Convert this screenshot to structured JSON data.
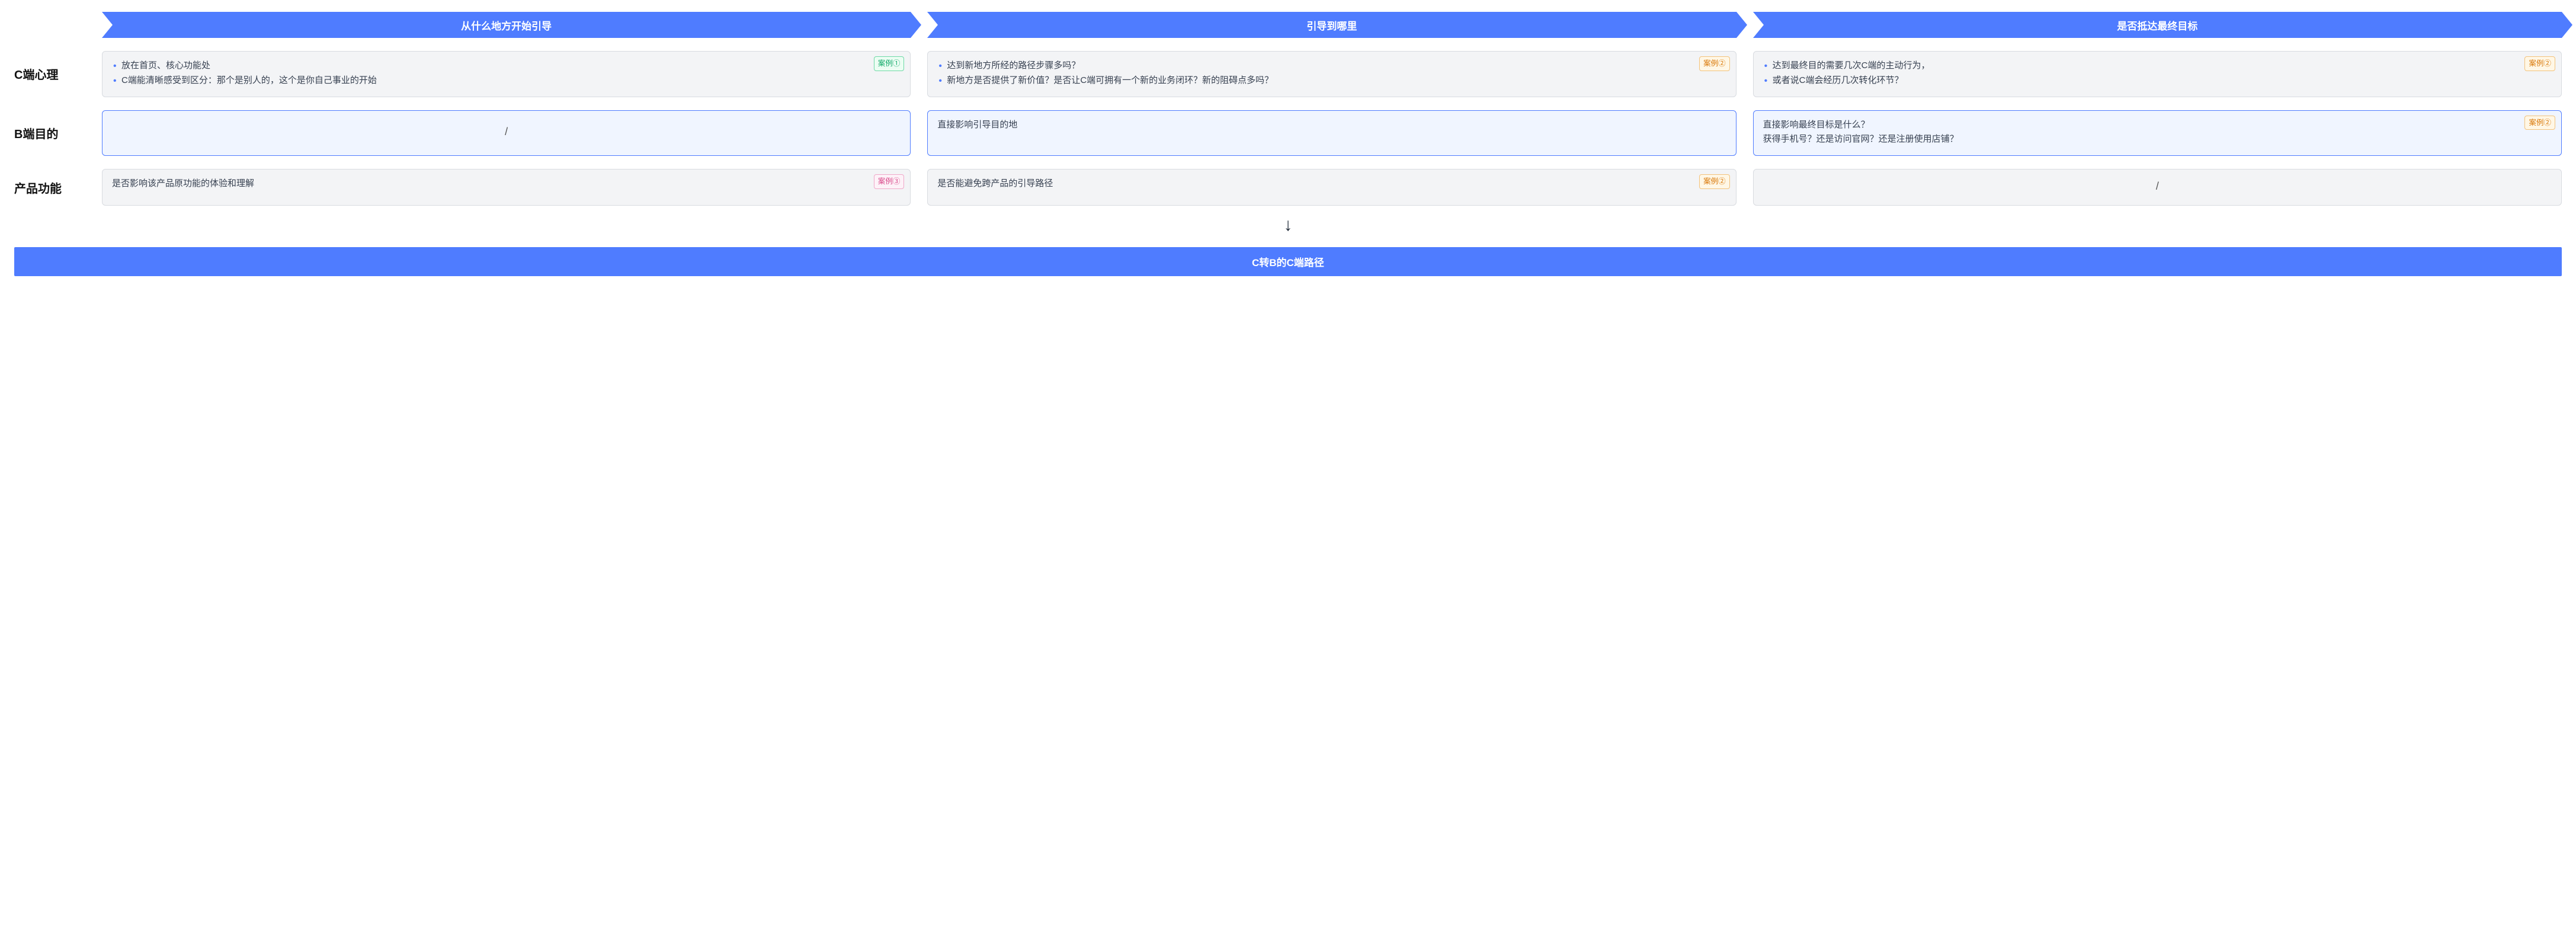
{
  "headers": {
    "col1": "从什么地方开始引导",
    "col2": "引导到哪里",
    "col3": "是否抵达最终目标"
  },
  "rows": {
    "r1_label": "C端心理",
    "r2_label": "B端目的",
    "r3_label": "产品功能"
  },
  "tags": {
    "case1": "案例①",
    "case2": "案例②",
    "case3": "案例③"
  },
  "cells": {
    "r1c1_li1": "放在首页、核心功能处",
    "r1c1_li2": "C端能清晰感受到区分：那个是别人的，这个是你自己事业的开始",
    "r1c2_li1": "达到新地方所经的路径步骤多吗？",
    "r1c2_li2": "新地方是否提供了新价值？是否让C端可拥有一个新的业务闭环？新的阻碍点多吗？",
    "r1c3_li1": "达到最终目的需要几次C端的主动行为，",
    "r1c3_li2": "或者说C端会经历几次转化环节？",
    "r2c1": "/",
    "r2c2": "直接影响引导目的地",
    "r2c3_line1": "直接影响最终目标是什么？",
    "r2c3_line2": "获得手机号？还是访问官网？还是注册使用店铺？",
    "r3c1": "是否影响该产品原功能的体验和理解",
    "r3c2": "是否能避免跨产品的引导路径",
    "r3c3": "/"
  },
  "arrow_down": "↓",
  "footer": "C转B的C端路径"
}
